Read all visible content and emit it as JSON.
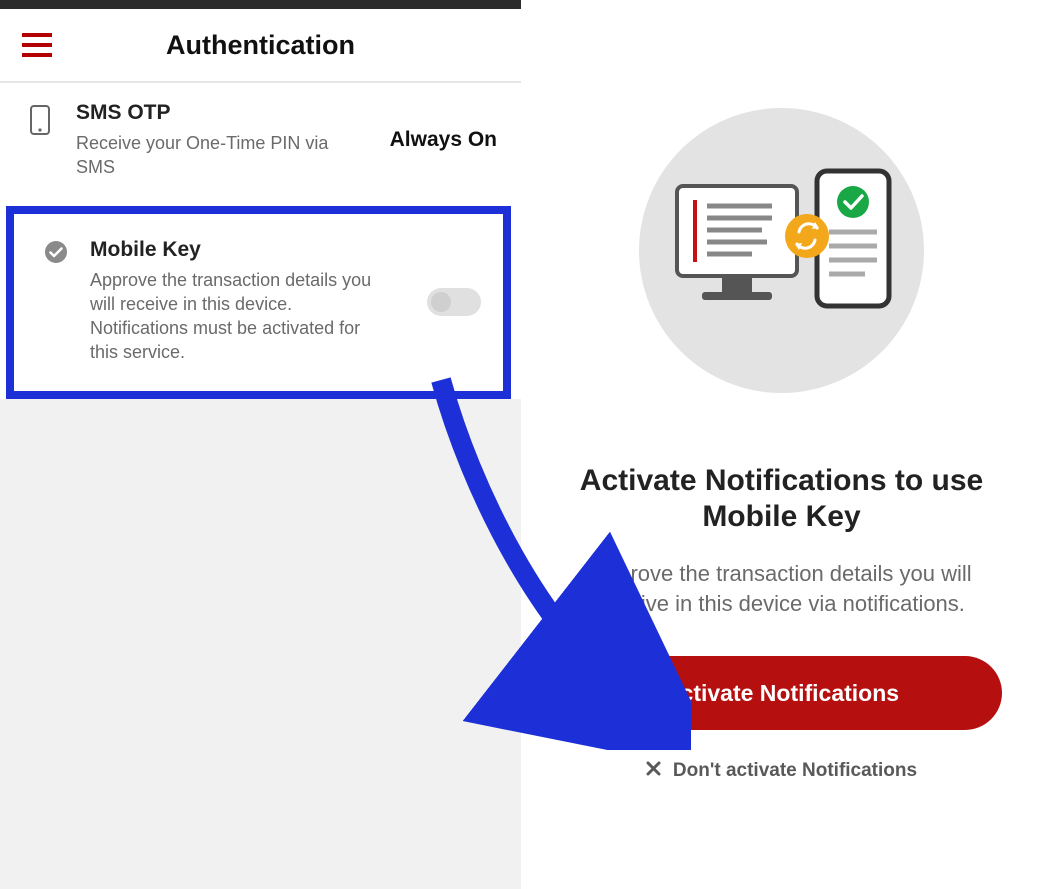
{
  "left": {
    "header_title": "Authentication",
    "sms": {
      "title": "SMS OTP",
      "desc": "Receive your One-Time PIN via SMS",
      "status": "Always On"
    },
    "mobile_key": {
      "title": "Mobile Key",
      "desc": "Approve the transaction details you will receive in this device. Notifications must be activated for this service."
    }
  },
  "right": {
    "title": "Activate Notifications to use Mobile Key",
    "desc": "Approve the transaction details you will receive in this device via notifications.",
    "activate_label": "Activate Notifications",
    "dont_activate_label": "Don't activate Notifications"
  }
}
